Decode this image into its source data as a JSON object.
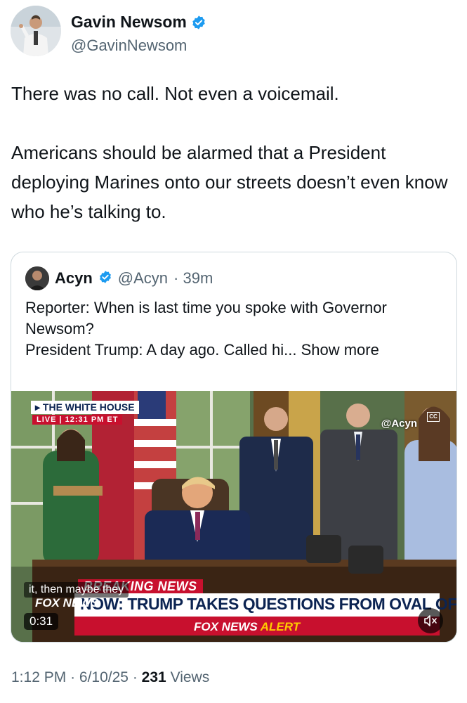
{
  "author": {
    "name": "Gavin Newsom",
    "handle": "@GavinNewsom",
    "verified_color": "#1d9bf0"
  },
  "tweet": {
    "line1": "There was no call. Not even a voicemail.",
    "line2": "Americans should be alarmed that a President deploying Marines onto our streets doesn’t even know who he’s talking to."
  },
  "quote": {
    "name": "Acyn",
    "handle": "@Acyn",
    "time": "· 39m",
    "line1": "Reporter: When is last time you spoke with Governor Newsom?",
    "line2": "President Trump: A day ago. Called hi...",
    "show_more": "Show more",
    "video": {
      "location_label": "THE WHITE HOUSE",
      "live_label": "LIVE | 12:31 PM ET",
      "watermark": "@Acyn",
      "cc_label": "CC",
      "caption": "it, then maybe they",
      "breaking_label": "BREAKING NEWS",
      "headline": "NOW: TRUMP TAKES QUESTIONS FROM OVAL OFFICE",
      "alert_prefix": "FOX NEWS",
      "alert_suffix": "ALERT",
      "channel_logo": "FOX NEWS",
      "duration": "0:31",
      "mute_icon": "speaker-muted-icon"
    }
  },
  "footer": {
    "time": "1:12 PM",
    "sep1": "·",
    "date": "6/10/25",
    "sep2": "·",
    "views_count": "231",
    "views_label": "Views"
  }
}
